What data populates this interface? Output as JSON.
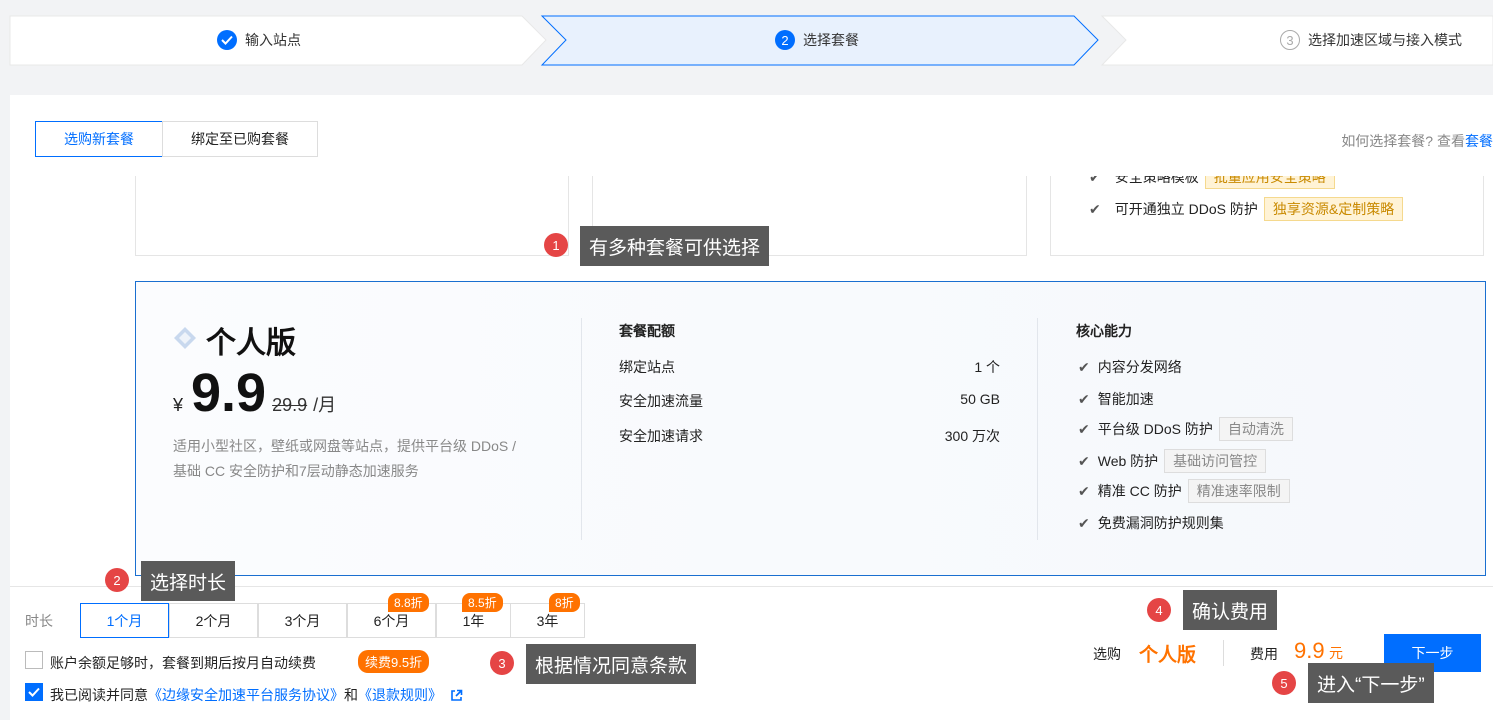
{
  "stepper": {
    "steps": [
      {
        "number": "",
        "label": "输入站点",
        "state": "done"
      },
      {
        "number": "2",
        "label": "选择套餐",
        "state": "active"
      },
      {
        "number": "3",
        "label": "选择加速区域与接入模式",
        "state": "pending"
      }
    ]
  },
  "tabs": [
    {
      "label": "选购新套餐",
      "active": true
    },
    {
      "label": "绑定至已购套餐",
      "active": false
    }
  ],
  "help": {
    "text": "如何选择套餐? 查看",
    "link": "套餐"
  },
  "ghost_features": [
    {
      "label": "安全策略模板",
      "tag": "批量应用安全策略"
    },
    {
      "label": "可开通独立 DDoS 防护",
      "tag": "独享资源&定制策略"
    }
  ],
  "plan": {
    "name": "个人版",
    "currency": "¥",
    "price": "9.9",
    "original_price": "29.9",
    "unit": "/月",
    "description_line1": "适用小型社区，壁纸或网盘等站点，提供平台级 DDoS /",
    "description_line2": "基础 CC 安全防护和7层动静态加速服务",
    "quota_title": "套餐配额",
    "quotas": [
      {
        "label": "绑定站点",
        "value": "1 个"
      },
      {
        "label": "安全加速流量",
        "value": "50 GB"
      },
      {
        "label": "安全加速请求",
        "value": "300 万次"
      }
    ],
    "capability_title": "核心能力",
    "capabilities": [
      {
        "label": "内容分发网络",
        "tag": ""
      },
      {
        "label": "智能加速",
        "tag": ""
      },
      {
        "label": "平台级 DDoS 防护",
        "tag": "自动清洗"
      },
      {
        "label": "Web 防护",
        "tag": "基础访问管控"
      },
      {
        "label": "精准 CC 防护",
        "tag": "精准速率限制"
      },
      {
        "label": "免费漏洞防护规则集",
        "tag": ""
      }
    ]
  },
  "duration": {
    "label": "时长",
    "options": [
      {
        "label": "1个月",
        "discount": "",
        "selected": true
      },
      {
        "label": "2个月",
        "discount": "",
        "selected": false
      },
      {
        "label": "3个月",
        "discount": "",
        "selected": false
      },
      {
        "label": "6个月",
        "discount": "8.8折",
        "selected": false
      },
      {
        "label": "1年",
        "discount": "8.5折",
        "selected": false
      },
      {
        "label": "3年",
        "discount": "8折",
        "selected": false
      }
    ]
  },
  "agreements": {
    "auto_renew": {
      "text": "账户余额足够时，套餐到期后按月自动续费",
      "checked": false,
      "badge": "续费9.5折"
    },
    "terms": {
      "prefix": "我已阅读并同意",
      "link1": "《边缘安全加速平台服务协议》",
      "and": "和",
      "link2": "《退款规则》",
      "checked": true
    }
  },
  "summary": {
    "purchase_label": "选购",
    "plan_name": "个人版",
    "fee_label": "费用",
    "fee_value": "9.9",
    "fee_unit": "元",
    "next_button": "下一步"
  },
  "tips": [
    {
      "num": "1",
      "text": "有多种套餐可供选择"
    },
    {
      "num": "2",
      "text": "选择时长"
    },
    {
      "num": "3",
      "text": "根据情况同意条款"
    },
    {
      "num": "4",
      "text": "确认费用"
    },
    {
      "num": "5",
      "text": "进入“下一步”"
    }
  ],
  "colors": {
    "accent": "#006eff",
    "orange": "#ff7200",
    "tip_red": "#e54545",
    "tip_bg": "#5a5a5a"
  }
}
